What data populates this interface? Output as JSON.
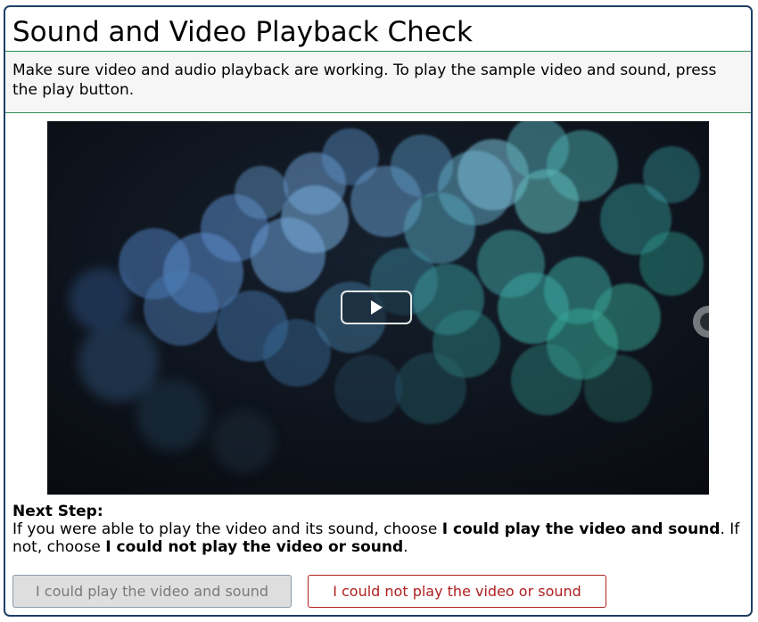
{
  "dialog": {
    "title": "Sound and Video Playback Check",
    "instructions": "Make sure video and audio playback are working. To play the sample video and sound, press the play button."
  },
  "video": {
    "play_icon": "play-icon"
  },
  "next_step": {
    "heading": "Next Step:",
    "text_1": "If you were able to play the video and its sound, choose ",
    "bold_1": "I could play the video and sound",
    "text_2": ". If not, choose ",
    "bold_2": "I could not play the video or sound",
    "text_3": "."
  },
  "buttons": {
    "yes_label": "I could play the video and sound",
    "no_label": "I could not play the video or sound"
  },
  "colors": {
    "border": "#1f3f66",
    "divider": "#2e8b57",
    "no_button": "#b02020"
  }
}
